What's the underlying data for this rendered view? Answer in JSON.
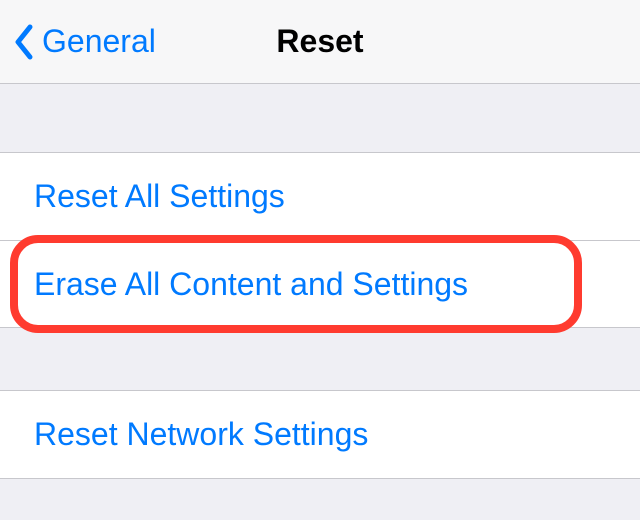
{
  "navbar": {
    "back_label": "General",
    "title": "Reset"
  },
  "group1": {
    "items": [
      {
        "label": "Reset All Settings"
      },
      {
        "label": "Erase All Content and Settings"
      }
    ]
  },
  "group2": {
    "items": [
      {
        "label": "Reset Network Settings"
      }
    ]
  },
  "colors": {
    "accent": "#007aff",
    "highlight": "#ff3b2f"
  }
}
